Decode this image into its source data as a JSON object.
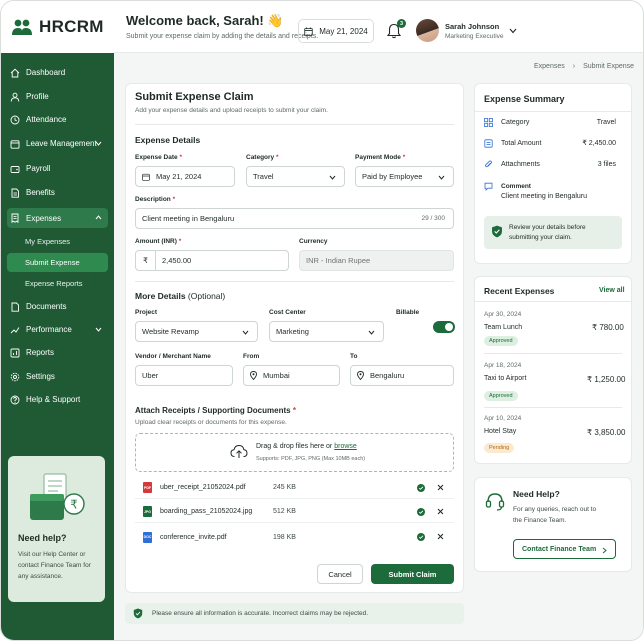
{
  "brand": {
    "name": "HRCRM"
  },
  "header": {
    "welcome": "Welcome back, Sarah! 👋",
    "subtitle": "Submit your expense claim by adding the details and receipts.",
    "date": "May 21, 2024",
    "notification_count": "3",
    "user_name": "Sarah Johnson",
    "user_role": "Marketing Executive"
  },
  "sidebar": {
    "items": [
      {
        "label": "Dashboard"
      },
      {
        "label": "Profile"
      },
      {
        "label": "Attendance"
      },
      {
        "label": "Leave Management"
      },
      {
        "label": "Payroll"
      },
      {
        "label": "Benefits"
      },
      {
        "label": "Expenses"
      },
      {
        "label": "Documents"
      },
      {
        "label": "Performance"
      },
      {
        "label": "Reports"
      },
      {
        "label": "Settings"
      },
      {
        "label": "Help & Support"
      }
    ],
    "expense_sub": [
      {
        "label": "My Expenses"
      },
      {
        "label": "Submit Expense"
      },
      {
        "label": "Expense Reports"
      }
    ],
    "help": {
      "title": "Need help?",
      "text": "Visit our Help Center or contact Finance Team for any assistance."
    }
  },
  "breadcrumb": {
    "parent": "Expenses",
    "current": "Submit Expense"
  },
  "form": {
    "title": "Submit Expense Claim",
    "subtitle": "Add your expense details and upload receipts to submit your claim.",
    "details_title": "Expense Details",
    "expense_date_label": "Expense Date",
    "expense_date": "May 21, 2024",
    "category_label": "Category",
    "category": "Travel",
    "payment_mode_label": "Payment Mode",
    "payment_mode": "Paid by Employee",
    "description_label": "Description",
    "description": "Client meeting in Bengaluru",
    "description_count": "29 / 300",
    "amount_label": "Amount (INR)",
    "currency_symbol": "₹",
    "amount": "2,450.00",
    "currency_label": "Currency",
    "currency": "INR - Indian Rupee",
    "more_title": "More Details",
    "optional": "(Optional)",
    "project_label": "Project",
    "project": "Website Revamp",
    "cost_center_label": "Cost Center",
    "cost_center": "Marketing",
    "billable_label": "Billable",
    "vendor_label": "Vendor / Merchant Name",
    "vendor": "Uber",
    "from_label": "From",
    "from": "Mumbai",
    "to_label": "To",
    "to": "Bengaluru",
    "attach_title": "Attach Receipts / Supporting Documents",
    "attach_sub": "Upload clear receipts or documents for this expense.",
    "drop_text": "Drag & drop files here or",
    "browse": "browse",
    "drop_hint": "Supports: PDF, JPG, PNG (Max 10MB each)",
    "files": [
      {
        "tag": "PDF",
        "name": "uber_receipt_21052024.pdf",
        "size": "245 KB"
      },
      {
        "tag": "JPG",
        "name": "boarding_pass_21052024.jpg",
        "size": "512 KB"
      },
      {
        "tag": "DOC",
        "name": "conference_invite.pdf",
        "size": "198 KB"
      }
    ],
    "cancel": "Cancel",
    "submit": "Submit Claim",
    "note": "Please ensure all information is accurate. Incorrect claims may be rejected."
  },
  "summary": {
    "title": "Expense Summary",
    "category_label": "Category",
    "category": "Travel",
    "total_label": "Total Amount",
    "total": "₹ 2,450.00",
    "attachments_label": "Attachments",
    "attachments": "3 files",
    "comment_label": "Comment",
    "comment": "Client meeting in Bengaluru",
    "review": "Review your details before submitting your claim."
  },
  "recent": {
    "title": "Recent Expenses",
    "view_all": "View all",
    "items": [
      {
        "date": "Apr 30, 2024",
        "name": "Team Lunch",
        "amount": "₹ 780.00",
        "status": "Approved"
      },
      {
        "date": "Apr 18, 2024",
        "name": "Taxi to Airport",
        "amount": "₹ 1,250.00",
        "status": "Approved"
      },
      {
        "date": "Apr 10, 2024",
        "name": "Hotel Stay",
        "amount": "₹ 3,850.00",
        "status": "Pending"
      }
    ]
  },
  "support": {
    "title": "Need Help?",
    "text": "For any queries, reach out to the Finance Team.",
    "button": "Contact Finance Team"
  },
  "colors": {
    "primary": "#1d6a3a",
    "sidebar": "#1f5a35",
    "active": "#2e7a4a",
    "danger": "#d23b3b"
  }
}
